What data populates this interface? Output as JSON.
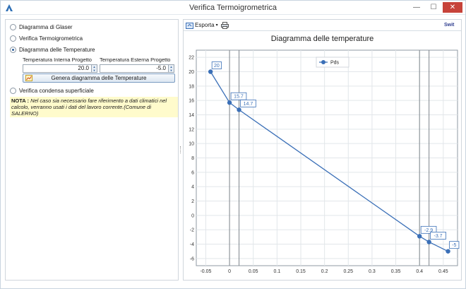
{
  "window": {
    "title": "Verifica Termoigrometrica",
    "minimize_glyph": "—",
    "maximize_glyph": "☐",
    "close_glyph": "✕"
  },
  "left": {
    "options": [
      {
        "label": "Diagramma di Glaser",
        "checked": false
      },
      {
        "label": "Verifica Termoigrometrica",
        "checked": false
      },
      {
        "label": "Diagramma delle Temperature",
        "checked": true
      },
      {
        "label": "Verifica condensa superficiale",
        "checked": false
      }
    ],
    "temp_interna_label": "Temperatura Interna Progetto",
    "temp_esterna_label": "Temperatura Esterna Progetto",
    "temp_interna_value": "20.0",
    "temp_esterna_value": "-5.0",
    "generate_button": "Genera diagramma delle Temperature",
    "note_label": "NOTA :",
    "note_text": "Nel caso sia necessario fare riferimento a dati climatici nel calcolo, verranno usati i dati del lavoro corrente.(Comune di SALERNO)"
  },
  "toolbar": {
    "export_label": "Esporta",
    "brand_text": "Swit"
  },
  "colors": {
    "series": "#3a6fb7",
    "grid": "#e2e6ea",
    "axis": "#8f99a3",
    "layer_line": "#7f868c"
  },
  "chart_data": {
    "type": "line",
    "title": "Diagramma delle temperature",
    "xlabel": "",
    "ylabel": "",
    "xlim": [
      -0.07,
      0.48
    ],
    "ylim": [
      -7,
      23
    ],
    "x_ticks": [
      -0.05,
      0,
      0.05,
      0.1,
      0.15,
      0.2,
      0.25,
      0.3,
      0.35,
      0.4,
      0.45
    ],
    "y_ticks": [
      -6,
      -4,
      -2,
      0,
      2,
      4,
      6,
      8,
      10,
      12,
      14,
      16,
      18,
      20,
      22
    ],
    "grid": true,
    "legend_position": "top-center",
    "layer_boundaries": [
      0,
      0.02,
      0.4,
      0.42
    ],
    "series": [
      {
        "name": "Pds",
        "x": [
          -0.04,
          0,
          0.02,
          0.4,
          0.42,
          0.46
        ],
        "y": [
          20,
          15.7,
          14.7,
          -2.9,
          -3.7,
          -5
        ],
        "labels": [
          "20",
          "15.7",
          "14.7",
          "-2.9",
          "-3.7",
          "-5"
        ]
      }
    ]
  }
}
